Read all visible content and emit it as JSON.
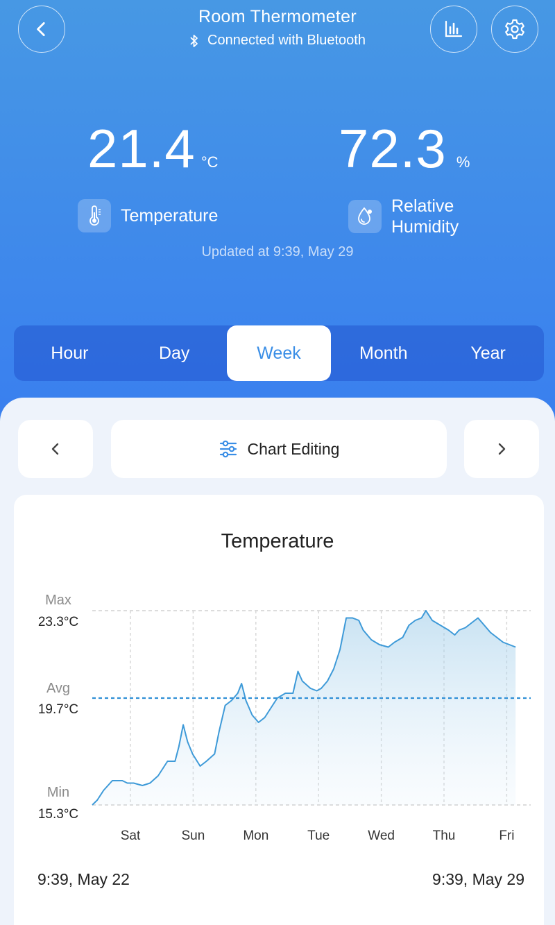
{
  "header": {
    "title": "Room Thermometer",
    "subtitle": "Connected with Bluetooth"
  },
  "readings": {
    "temperature": {
      "value": "21.4",
      "unit": "°C",
      "label": "Temperature"
    },
    "humidity": {
      "value": "72.3",
      "unit": "%",
      "label_line1": "Relative",
      "label_line2": "Humidity"
    }
  },
  "updated": "Updated at 9:39,  May 29",
  "tabs": [
    "Hour",
    "Day",
    "Week",
    "Month",
    "Year"
  ],
  "active_tab": "Week",
  "chart_editing_label": "Chart Editing",
  "chart": {
    "title": "Temperature",
    "max_label": "Max",
    "max_value": "23.3°C",
    "avg_label": "Avg",
    "avg_value": "19.7°C",
    "min_label": "Min",
    "min_value": "15.3°C",
    "start_label": "9:39,  May 22",
    "end_label": "9:39,  May 29"
  },
  "chart_data": {
    "type": "area",
    "title": "Temperature",
    "x_labels": [
      "Sat",
      "Sun",
      "Mon",
      "Tue",
      "Wed",
      "Thu",
      "Fri"
    ],
    "ylim": [
      15.3,
      23.3
    ],
    "reference_lines": {
      "max": 23.3,
      "avg": 19.7,
      "min": 15.3
    },
    "x_range": [
      "9:39, May 22",
      "9:39, May 29"
    ],
    "series": [
      {
        "values": [
          [
            0.0,
            15.3
          ],
          [
            0.08,
            15.5
          ],
          [
            0.18,
            15.9
          ],
          [
            0.32,
            16.3
          ],
          [
            0.48,
            16.3
          ],
          [
            0.56,
            16.2
          ],
          [
            0.66,
            16.2
          ],
          [
            0.8,
            16.1
          ],
          [
            0.92,
            16.2
          ],
          [
            1.05,
            16.5
          ],
          [
            1.2,
            17.1
          ],
          [
            1.32,
            17.1
          ],
          [
            1.38,
            17.7
          ],
          [
            1.45,
            18.6
          ],
          [
            1.52,
            17.9
          ],
          [
            1.6,
            17.4
          ],
          [
            1.72,
            16.9
          ],
          [
            1.82,
            17.1
          ],
          [
            1.95,
            17.4
          ],
          [
            2.02,
            18.3
          ],
          [
            2.12,
            19.4
          ],
          [
            2.22,
            19.6
          ],
          [
            2.32,
            19.9
          ],
          [
            2.38,
            20.3
          ],
          [
            2.45,
            19.6
          ],
          [
            2.55,
            19.0
          ],
          [
            2.65,
            18.7
          ],
          [
            2.75,
            18.9
          ],
          [
            2.85,
            19.3
          ],
          [
            2.95,
            19.7
          ],
          [
            3.08,
            19.9
          ],
          [
            3.2,
            19.9
          ],
          [
            3.28,
            20.8
          ],
          [
            3.35,
            20.4
          ],
          [
            3.48,
            20.1
          ],
          [
            3.58,
            20.0
          ],
          [
            3.65,
            20.1
          ],
          [
            3.75,
            20.4
          ],
          [
            3.85,
            20.9
          ],
          [
            3.95,
            21.7
          ],
          [
            4.05,
            23.0
          ],
          [
            4.15,
            23.0
          ],
          [
            4.25,
            22.9
          ],
          [
            4.32,
            22.5
          ],
          [
            4.45,
            22.1
          ],
          [
            4.58,
            21.9
          ],
          [
            4.72,
            21.8
          ],
          [
            4.82,
            22.0
          ],
          [
            4.95,
            22.2
          ],
          [
            5.05,
            22.7
          ],
          [
            5.15,
            22.9
          ],
          [
            5.25,
            23.0
          ],
          [
            5.32,
            23.3
          ],
          [
            5.42,
            22.9
          ],
          [
            5.55,
            22.7
          ],
          [
            5.68,
            22.5
          ],
          [
            5.78,
            22.3
          ],
          [
            5.85,
            22.5
          ],
          [
            5.95,
            22.6
          ],
          [
            6.05,
            22.8
          ],
          [
            6.15,
            23.0
          ],
          [
            6.25,
            22.7
          ],
          [
            6.35,
            22.4
          ],
          [
            6.45,
            22.2
          ],
          [
            6.55,
            22.0
          ],
          [
            6.65,
            21.9
          ],
          [
            6.75,
            21.8
          ]
        ]
      }
    ]
  }
}
